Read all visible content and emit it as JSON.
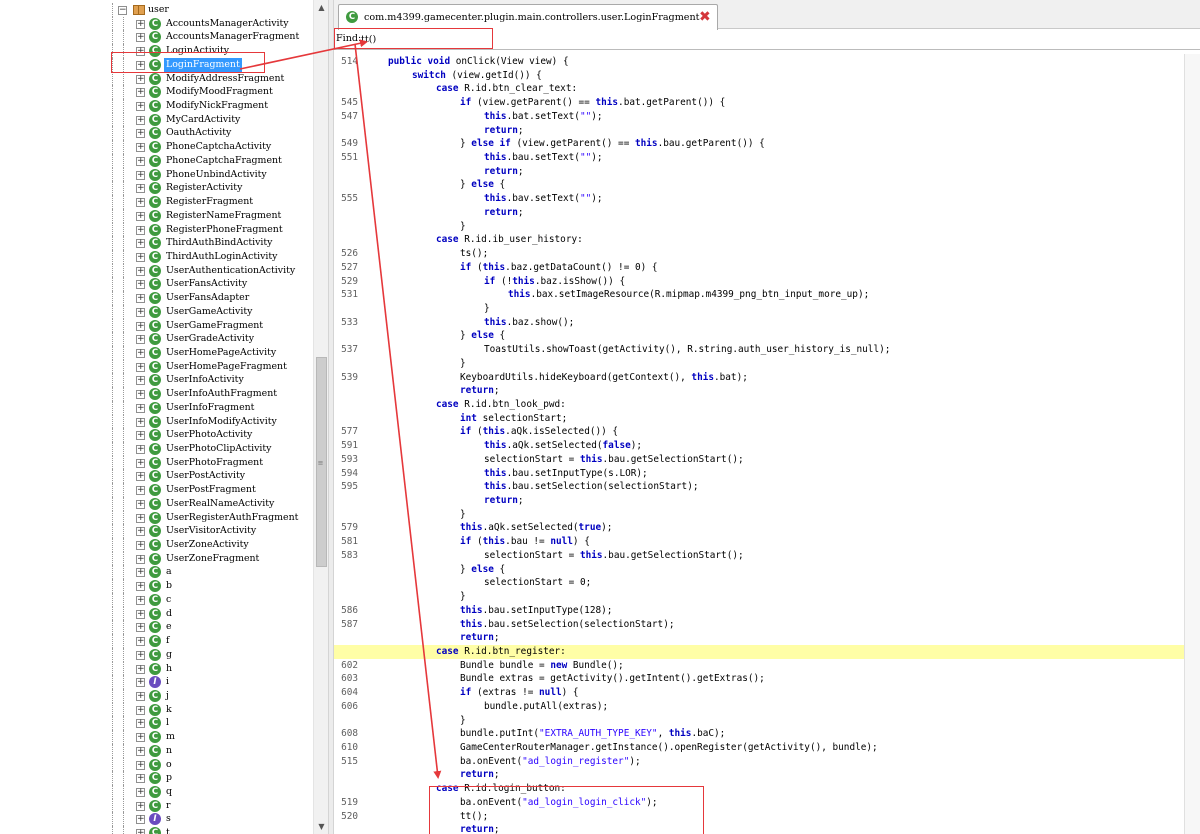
{
  "tree": {
    "package": "user",
    "items": [
      {
        "name": "AccountsManagerActivity",
        "kind": "class"
      },
      {
        "name": "AccountsManagerFragment",
        "kind": "class"
      },
      {
        "name": "LoginActivity",
        "kind": "class"
      },
      {
        "name": "LoginFragment",
        "kind": "class",
        "selected": true
      },
      {
        "name": "ModifyAddressFragment",
        "kind": "class"
      },
      {
        "name": "ModifyMoodFragment",
        "kind": "class"
      },
      {
        "name": "ModifyNickFragment",
        "kind": "class"
      },
      {
        "name": "MyCardActivity",
        "kind": "class"
      },
      {
        "name": "OauthActivity",
        "kind": "class"
      },
      {
        "name": "PhoneCaptchaActivity",
        "kind": "class"
      },
      {
        "name": "PhoneCaptchaFragment",
        "kind": "class"
      },
      {
        "name": "PhoneUnbindActivity",
        "kind": "class"
      },
      {
        "name": "RegisterActivity",
        "kind": "class"
      },
      {
        "name": "RegisterFragment",
        "kind": "class"
      },
      {
        "name": "RegisterNameFragment",
        "kind": "class"
      },
      {
        "name": "RegisterPhoneFragment",
        "kind": "class"
      },
      {
        "name": "ThirdAuthBindActivity",
        "kind": "class"
      },
      {
        "name": "ThirdAuthLoginActivity",
        "kind": "class"
      },
      {
        "name": "UserAuthenticationActivity",
        "kind": "class"
      },
      {
        "name": "UserFansActivity",
        "kind": "class"
      },
      {
        "name": "UserFansAdapter",
        "kind": "class"
      },
      {
        "name": "UserGameActivity",
        "kind": "class"
      },
      {
        "name": "UserGameFragment",
        "kind": "class"
      },
      {
        "name": "UserGradeActivity",
        "kind": "class"
      },
      {
        "name": "UserHomePageActivity",
        "kind": "class"
      },
      {
        "name": "UserHomePageFragment",
        "kind": "class"
      },
      {
        "name": "UserInfoActivity",
        "kind": "class"
      },
      {
        "name": "UserInfoAuthFragment",
        "kind": "class"
      },
      {
        "name": "UserInfoFragment",
        "kind": "class"
      },
      {
        "name": "UserInfoModifyActivity",
        "kind": "class"
      },
      {
        "name": "UserPhotoActivity",
        "kind": "class"
      },
      {
        "name": "UserPhotoClipActivity",
        "kind": "class"
      },
      {
        "name": "UserPhotoFragment",
        "kind": "class"
      },
      {
        "name": "UserPostActivity",
        "kind": "class"
      },
      {
        "name": "UserPostFragment",
        "kind": "class"
      },
      {
        "name": "UserRealNameActivity",
        "kind": "class"
      },
      {
        "name": "UserRegisterAuthFragment",
        "kind": "class"
      },
      {
        "name": "UserVisitorActivity",
        "kind": "class"
      },
      {
        "name": "UserZoneActivity",
        "kind": "class"
      },
      {
        "name": "UserZoneFragment",
        "kind": "class"
      },
      {
        "name": "a",
        "kind": "class"
      },
      {
        "name": "b",
        "kind": "class"
      },
      {
        "name": "c",
        "kind": "class"
      },
      {
        "name": "d",
        "kind": "class"
      },
      {
        "name": "e",
        "kind": "class"
      },
      {
        "name": "f",
        "kind": "class"
      },
      {
        "name": "g",
        "kind": "class"
      },
      {
        "name": "h",
        "kind": "class"
      },
      {
        "name": "i",
        "kind": "interface"
      },
      {
        "name": "j",
        "kind": "class"
      },
      {
        "name": "k",
        "kind": "class"
      },
      {
        "name": "l",
        "kind": "class"
      },
      {
        "name": "m",
        "kind": "class"
      },
      {
        "name": "n",
        "kind": "class"
      },
      {
        "name": "o",
        "kind": "class"
      },
      {
        "name": "p",
        "kind": "class"
      },
      {
        "name": "q",
        "kind": "class"
      },
      {
        "name": "r",
        "kind": "class"
      },
      {
        "name": "s",
        "kind": "interface"
      },
      {
        "name": "t",
        "kind": "class"
      }
    ]
  },
  "editor": {
    "tab_title": "com.m4399.gamecenter.plugin.main.controllers.user.LoginFragment",
    "close_glyph": "✖",
    "find_label": "Find:",
    "find_value": "tt()",
    "highlight_line_index": 43,
    "lines": [
      {
        "num": "514",
        "indent": 1,
        "tokens": [
          [
            "kw",
            "public void "
          ],
          [
            "",
            "onClick(View view) {"
          ]
        ]
      },
      {
        "num": "",
        "indent": 2,
        "tokens": [
          [
            "kw",
            "switch "
          ],
          [
            "",
            "(view.getId()) {"
          ]
        ]
      },
      {
        "num": "",
        "indent": 3,
        "tokens": [
          [
            "kw",
            "case "
          ],
          [
            "",
            "R.id.btn_clear_text:"
          ]
        ]
      },
      {
        "num": "545",
        "indent": 4,
        "tokens": [
          [
            "kw",
            "if "
          ],
          [
            "",
            "(view.getParent() == "
          ],
          [
            "kw",
            "this"
          ],
          [
            "",
            ".bat.getParent()) {"
          ]
        ]
      },
      {
        "num": "547",
        "indent": 5,
        "tokens": [
          [
            "kw",
            "this"
          ],
          [
            "",
            ".bat.setText("
          ],
          [
            "str",
            "\"\""
          ],
          [
            "",
            ");"
          ]
        ]
      },
      {
        "num": "",
        "indent": 5,
        "tokens": [
          [
            "kw",
            "return"
          ],
          [
            "",
            ";"
          ]
        ]
      },
      {
        "num": "549",
        "indent": 4,
        "tokens": [
          [
            "",
            "} "
          ],
          [
            "kw",
            "else if "
          ],
          [
            "",
            "(view.getParent() == "
          ],
          [
            "kw",
            "this"
          ],
          [
            "",
            ".bau.getParent()) {"
          ]
        ]
      },
      {
        "num": "551",
        "indent": 5,
        "tokens": [
          [
            "kw",
            "this"
          ],
          [
            "",
            ".bau.setText("
          ],
          [
            "str",
            "\"\""
          ],
          [
            "",
            ");"
          ]
        ]
      },
      {
        "num": "",
        "indent": 5,
        "tokens": [
          [
            "kw",
            "return"
          ],
          [
            "",
            ";"
          ]
        ]
      },
      {
        "num": "",
        "indent": 4,
        "tokens": [
          [
            "",
            "} "
          ],
          [
            "kw",
            "else "
          ],
          [
            "",
            "{"
          ]
        ]
      },
      {
        "num": "555",
        "indent": 5,
        "tokens": [
          [
            "kw",
            "this"
          ],
          [
            "",
            ".bav.setText("
          ],
          [
            "str",
            "\"\""
          ],
          [
            "",
            ");"
          ]
        ]
      },
      {
        "num": "",
        "indent": 5,
        "tokens": [
          [
            "kw",
            "return"
          ],
          [
            "",
            ";"
          ]
        ]
      },
      {
        "num": "",
        "indent": 4,
        "tokens": [
          [
            "",
            "}"
          ]
        ]
      },
      {
        "num": "",
        "indent": 3,
        "tokens": [
          [
            "kw",
            "case "
          ],
          [
            "",
            "R.id.ib_user_history:"
          ]
        ]
      },
      {
        "num": "526",
        "indent": 4,
        "tokens": [
          [
            "",
            "ts();"
          ]
        ]
      },
      {
        "num": "527",
        "indent": 4,
        "tokens": [
          [
            "kw",
            "if "
          ],
          [
            "",
            "("
          ],
          [
            "kw",
            "this"
          ],
          [
            "",
            ".baz.getDataCount() != 0) {"
          ]
        ]
      },
      {
        "num": "529",
        "indent": 5,
        "tokens": [
          [
            "kw",
            "if "
          ],
          [
            "",
            "(!"
          ],
          [
            "kw",
            "this"
          ],
          [
            "",
            ".baz.isShow()) {"
          ]
        ]
      },
      {
        "num": "531",
        "indent": 6,
        "tokens": [
          [
            "kw",
            "this"
          ],
          [
            "",
            ".bax.setImageResource(R.mipmap.m4399_png_btn_input_more_up);"
          ]
        ]
      },
      {
        "num": "",
        "indent": 5,
        "tokens": [
          [
            "",
            "}"
          ]
        ]
      },
      {
        "num": "533",
        "indent": 5,
        "tokens": [
          [
            "kw",
            "this"
          ],
          [
            "",
            ".baz.show();"
          ]
        ]
      },
      {
        "num": "",
        "indent": 4,
        "tokens": [
          [
            "",
            "} "
          ],
          [
            "kw",
            "else "
          ],
          [
            "",
            "{"
          ]
        ]
      },
      {
        "num": "537",
        "indent": 5,
        "tokens": [
          [
            "",
            "ToastUtils.showToast(getActivity(), R.string.auth_user_history_is_null);"
          ]
        ]
      },
      {
        "num": "",
        "indent": 4,
        "tokens": [
          [
            "",
            "}"
          ]
        ]
      },
      {
        "num": "539",
        "indent": 4,
        "tokens": [
          [
            "",
            "KeyboardUtils.hideKeyboard(getContext(), "
          ],
          [
            "kw",
            "this"
          ],
          [
            "",
            ".bat);"
          ]
        ]
      },
      {
        "num": "",
        "indent": 4,
        "tokens": [
          [
            "kw",
            "return"
          ],
          [
            "",
            ";"
          ]
        ]
      },
      {
        "num": "",
        "indent": 3,
        "tokens": [
          [
            "kw",
            "case "
          ],
          [
            "",
            "R.id.btn_look_pwd:"
          ]
        ]
      },
      {
        "num": "",
        "indent": 4,
        "tokens": [
          [
            "kw",
            "int "
          ],
          [
            "",
            "selectionStart;"
          ]
        ]
      },
      {
        "num": "577",
        "indent": 4,
        "tokens": [
          [
            "kw",
            "if "
          ],
          [
            "",
            "("
          ],
          [
            "kw",
            "this"
          ],
          [
            "",
            ".aQk.isSelected()) {"
          ]
        ]
      },
      {
        "num": "591",
        "indent": 5,
        "tokens": [
          [
            "kw",
            "this"
          ],
          [
            "",
            ".aQk.setSelected("
          ],
          [
            "kw",
            "false"
          ],
          [
            "",
            ");"
          ]
        ]
      },
      {
        "num": "593",
        "indent": 5,
        "tokens": [
          [
            "",
            "selectionStart = "
          ],
          [
            "kw",
            "this"
          ],
          [
            "",
            ".bau.getSelectionStart();"
          ]
        ]
      },
      {
        "num": "594",
        "indent": 5,
        "tokens": [
          [
            "kw",
            "this"
          ],
          [
            "",
            ".bau.setInputType(s.LOR);"
          ]
        ]
      },
      {
        "num": "595",
        "indent": 5,
        "tokens": [
          [
            "kw",
            "this"
          ],
          [
            "",
            ".bau.setSelection(selectionStart);"
          ]
        ]
      },
      {
        "num": "",
        "indent": 5,
        "tokens": [
          [
            "kw",
            "return"
          ],
          [
            "",
            ";"
          ]
        ]
      },
      {
        "num": "",
        "indent": 4,
        "tokens": [
          [
            "",
            "}"
          ]
        ]
      },
      {
        "num": "579",
        "indent": 4,
        "tokens": [
          [
            "kw",
            "this"
          ],
          [
            "",
            ".aQk.setSelected("
          ],
          [
            "kw",
            "true"
          ],
          [
            "",
            ");"
          ]
        ]
      },
      {
        "num": "581",
        "indent": 4,
        "tokens": [
          [
            "kw",
            "if "
          ],
          [
            "",
            "("
          ],
          [
            "kw",
            "this"
          ],
          [
            "",
            ".bau != "
          ],
          [
            "kw",
            "null"
          ],
          [
            "",
            ") {"
          ]
        ]
      },
      {
        "num": "583",
        "indent": 5,
        "tokens": [
          [
            "",
            "selectionStart = "
          ],
          [
            "kw",
            "this"
          ],
          [
            "",
            ".bau.getSelectionStart();"
          ]
        ]
      },
      {
        "num": "",
        "indent": 4,
        "tokens": [
          [
            "",
            "} "
          ],
          [
            "kw",
            "else "
          ],
          [
            "",
            "{"
          ]
        ]
      },
      {
        "num": "",
        "indent": 5,
        "tokens": [
          [
            "",
            "selectionStart = 0;"
          ]
        ]
      },
      {
        "num": "",
        "indent": 4,
        "tokens": [
          [
            "",
            "}"
          ]
        ]
      },
      {
        "num": "586",
        "indent": 4,
        "tokens": [
          [
            "kw",
            "this"
          ],
          [
            "",
            ".bau.setInputType(128);"
          ]
        ]
      },
      {
        "num": "587",
        "indent": 4,
        "tokens": [
          [
            "kw",
            "this"
          ],
          [
            "",
            ".bau.setSelection(selectionStart);"
          ]
        ]
      },
      {
        "num": "",
        "indent": 4,
        "tokens": [
          [
            "kw",
            "return"
          ],
          [
            "",
            ";"
          ]
        ]
      },
      {
        "num": "",
        "indent": 3,
        "tokens": [
          [
            "kw",
            "case "
          ],
          [
            "",
            "R.id.btn_register:"
          ]
        ]
      },
      {
        "num": "602",
        "indent": 4,
        "tokens": [
          [
            "",
            "Bundle bundle = "
          ],
          [
            "kw",
            "new "
          ],
          [
            "",
            "Bundle();"
          ]
        ]
      },
      {
        "num": "603",
        "indent": 4,
        "tokens": [
          [
            "",
            "Bundle extras = getActivity().getIntent().getExtras();"
          ]
        ]
      },
      {
        "num": "604",
        "indent": 4,
        "tokens": [
          [
            "kw",
            "if "
          ],
          [
            "",
            "(extras != "
          ],
          [
            "kw",
            "null"
          ],
          [
            "",
            ") {"
          ]
        ]
      },
      {
        "num": "606",
        "indent": 5,
        "tokens": [
          [
            "",
            "bundle.putAll(extras);"
          ]
        ]
      },
      {
        "num": "",
        "indent": 4,
        "tokens": [
          [
            "",
            "}"
          ]
        ]
      },
      {
        "num": "608",
        "indent": 4,
        "tokens": [
          [
            "",
            "bundle.putInt("
          ],
          [
            "str",
            "\"EXTRA_AUTH_TYPE_KEY\""
          ],
          [
            "",
            ", "
          ],
          [
            "kw",
            "this"
          ],
          [
            "",
            ".baC);"
          ]
        ]
      },
      {
        "num": "610",
        "indent": 4,
        "tokens": [
          [
            "",
            "GameCenterRouterManager.getInstance().openRegister(getActivity(), bundle);"
          ]
        ]
      },
      {
        "num": "515",
        "indent": 4,
        "tokens": [
          [
            "",
            "ba.onEvent("
          ],
          [
            "str",
            "\"ad_login_register\""
          ],
          [
            "",
            ");"
          ]
        ]
      },
      {
        "num": "",
        "indent": 4,
        "tokens": [
          [
            "kw",
            "return"
          ],
          [
            "",
            ";"
          ]
        ]
      },
      {
        "num": "",
        "indent": 3,
        "tokens": [
          [
            "kw",
            "case "
          ],
          [
            "",
            "R.id.login_button:"
          ]
        ]
      },
      {
        "num": "519",
        "indent": 4,
        "tokens": [
          [
            "",
            "ba.onEvent("
          ],
          [
            "str",
            "\"ad_login_login_click\""
          ],
          [
            "",
            ");"
          ]
        ]
      },
      {
        "num": "520",
        "indent": 4,
        "tokens": [
          [
            "",
            "tt();"
          ]
        ]
      },
      {
        "num": "",
        "indent": 4,
        "tokens": [
          [
            "kw",
            "return"
          ],
          [
            "",
            ";"
          ]
        ]
      }
    ]
  }
}
